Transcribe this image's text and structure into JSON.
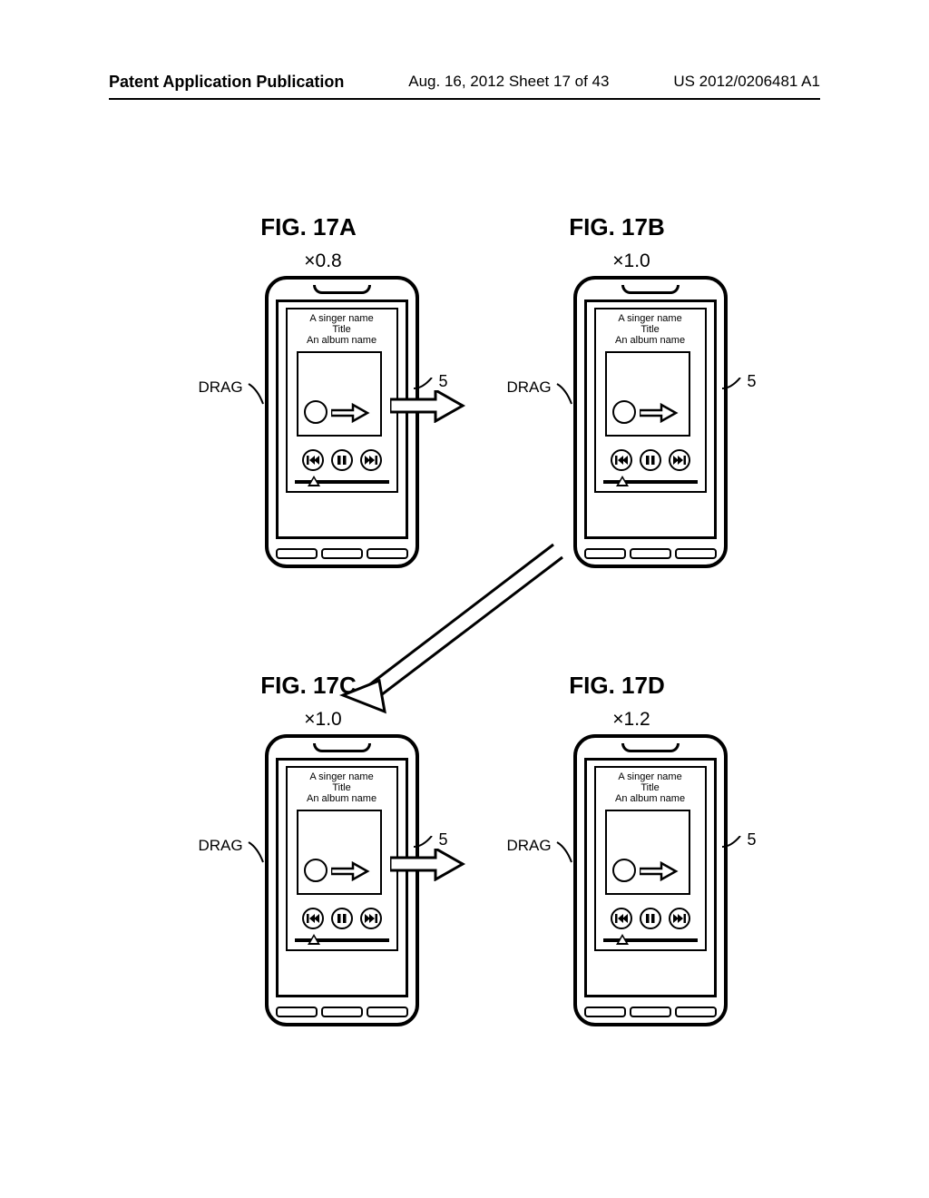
{
  "header": {
    "left": "Patent Application Publication",
    "center": "Aug. 16, 2012  Sheet 17 of 43",
    "right": "US 2012/0206481 A1"
  },
  "figures": {
    "a": {
      "label": "FIG. 17A",
      "zoom": "×0.8"
    },
    "b": {
      "label": "FIG. 17B",
      "zoom": "×1.0"
    },
    "c": {
      "label": "FIG. 17C",
      "zoom": "×1.0"
    },
    "d": {
      "label": "FIG. 17D",
      "zoom": "×1.2"
    }
  },
  "phone": {
    "drag_label": "DRAG",
    "song": {
      "line1": "A singer name",
      "line2": "Title",
      "line3": "An album name"
    },
    "callout_ref": "5"
  }
}
